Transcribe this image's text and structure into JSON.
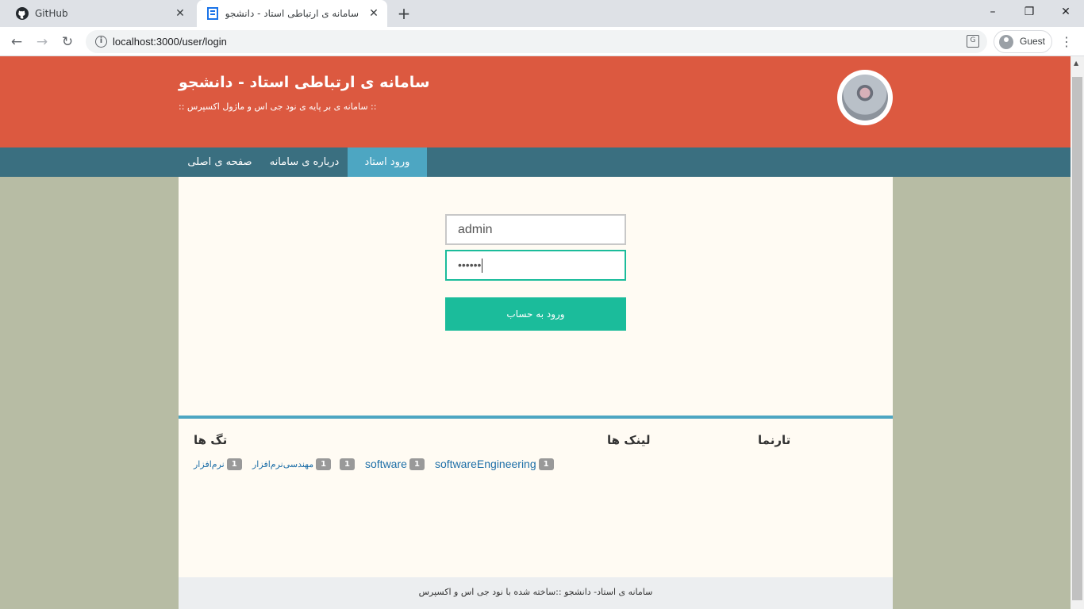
{
  "browser": {
    "tabs": [
      {
        "title": "GitHub",
        "icon": "github-icon"
      },
      {
        "title": "سامانه ی ارتباطی استاد - دانشجو",
        "icon": "site-favicon"
      }
    ],
    "url": "localhost:3000/user/login",
    "profile_label": "Guest",
    "controls": {
      "minimize": "–",
      "maximize": "❐",
      "close": "✕",
      "new_tab": "+",
      "back": "←",
      "forward": "→",
      "reload": "↻",
      "menu": "⋮",
      "tab_close": "✕"
    }
  },
  "header": {
    "title": "سامانه ی ارتباطی استاد - دانشجو",
    "subtitle": ":: سامانه ی بر پایه ی نود جی اس و ماژول اکسپرس ::"
  },
  "nav": {
    "items": [
      {
        "label": "صفحه ی اصلی",
        "active": false
      },
      {
        "label": "درباره ی سامانه",
        "active": false
      },
      {
        "label": "ورود استاد",
        "active": true
      }
    ]
  },
  "login": {
    "username_value": "admin",
    "password_value": "••••••",
    "submit_label": "ورود به حساب"
  },
  "widgets": {
    "blogroll_title": "تارنما",
    "links_title": "لینک ها",
    "tags_title": "تگ ها",
    "tags": [
      {
        "name": "softwareEngineering",
        "count": "1"
      },
      {
        "name": "software",
        "count": "1"
      },
      {
        "name": "",
        "count": "1"
      },
      {
        "name": "مهندسی‌نرم‌افزار",
        "count": "1"
      },
      {
        "name": "نرم‌افزار",
        "count": "1"
      }
    ]
  },
  "footer": {
    "text": "سامانه ی استاد- دانشجو ::ساخته شده با نود جی اس و اکسپرس"
  },
  "colors": {
    "header": "#dc5940",
    "nav": "#3a6f80",
    "nav_active": "#4da6c2",
    "button": "#1bbc9b",
    "page_bg": "#b7bca4",
    "content_bg": "#fffbf3"
  }
}
